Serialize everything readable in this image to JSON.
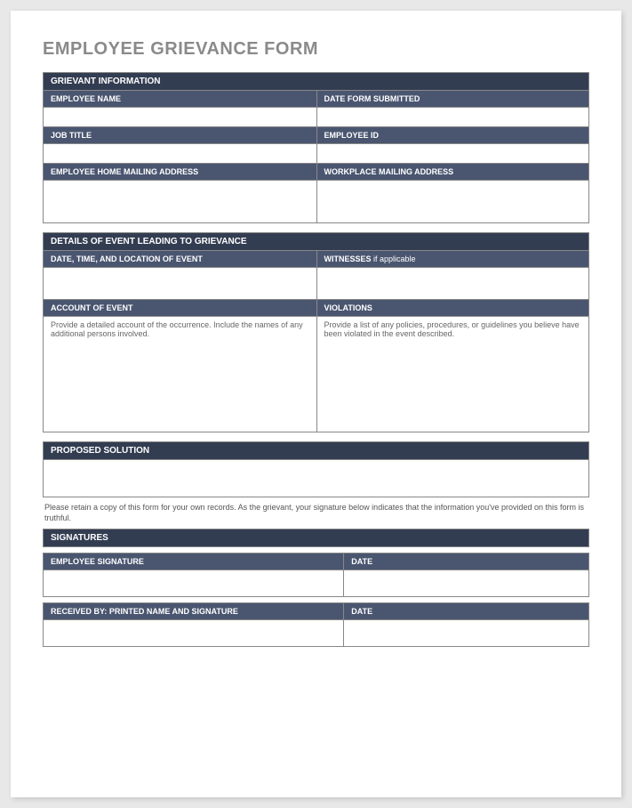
{
  "title": "EMPLOYEE GRIEVANCE FORM",
  "sections": {
    "grievant": {
      "header": "GRIEVANT INFORMATION",
      "row1": {
        "left_label": "EMPLOYEE NAME",
        "right_label": "DATE FORM SUBMITTED"
      },
      "row2": {
        "left_label": "JOB TITLE",
        "right_label": "EMPLOYEE ID"
      },
      "row3": {
        "left_label": "EMPLOYEE HOME MAILING ADDRESS",
        "right_label": "WORKPLACE MAILING ADDRESS"
      }
    },
    "details": {
      "header": "DETAILS OF EVENT LEADING TO GRIEVANCE",
      "row1": {
        "left_label": "DATE, TIME, AND LOCATION OF EVENT",
        "right_label_bold": "WITNESSES",
        "right_label_plain": " if applicable"
      },
      "row2": {
        "left_label": "ACCOUNT OF EVENT",
        "right_label": "VIOLATIONS",
        "left_hint": "Provide a detailed account of the occurrence. Include the names of any additional persons involved.",
        "right_hint": "Provide a list of any policies, procedures, or guidelines you believe have been violated in the event described."
      }
    },
    "proposed": {
      "header": "PROPOSED SOLUTION"
    },
    "note": "Please retain a copy of this form for your own records.  As the grievant, your signature below indicates that the information you've provided on this form is truthful.",
    "signatures": {
      "header": "SIGNATURES",
      "row1": {
        "left_label": "EMPLOYEE SIGNATURE",
        "right_label": "DATE"
      },
      "row2": {
        "left_label": "RECEIVED BY: PRINTED NAME AND SIGNATURE",
        "right_label": "DATE"
      }
    }
  }
}
